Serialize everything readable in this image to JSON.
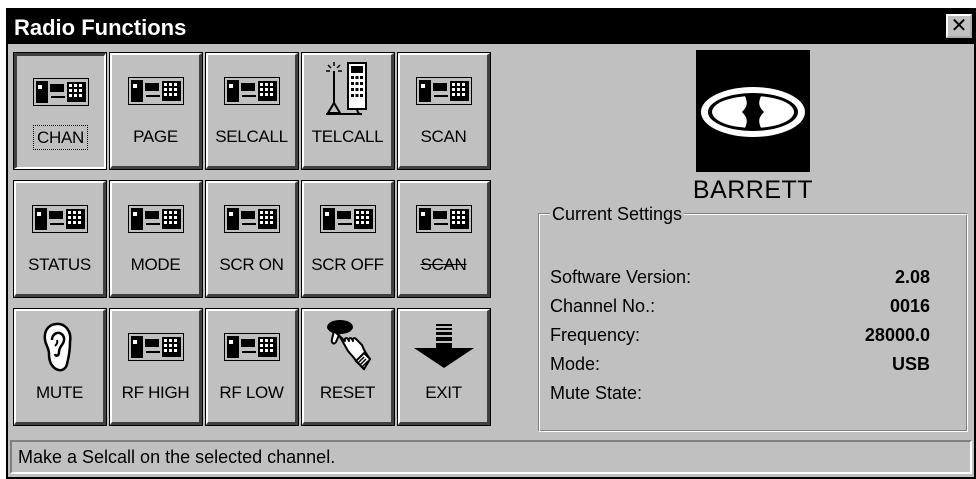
{
  "window": {
    "title": "Radio Functions",
    "close_label": "✕"
  },
  "buttons": [
    {
      "label": "CHAN",
      "icon": "radio-unit-icon"
    },
    {
      "label": "PAGE",
      "icon": "radio-unit-icon"
    },
    {
      "label": "SELCALL",
      "icon": "radio-unit-icon"
    },
    {
      "label": "TELCALL",
      "icon": "telephone-antenna-icon"
    },
    {
      "label": "SCAN",
      "icon": "radio-unit-icon"
    },
    {
      "label": "STATUS",
      "icon": "radio-unit-icon"
    },
    {
      "label": "MODE",
      "icon": "radio-unit-icon"
    },
    {
      "label": "SCR ON",
      "icon": "radio-unit-icon"
    },
    {
      "label": "SCR OFF",
      "icon": "radio-unit-icon"
    },
    {
      "label": "SCAN",
      "icon": "radio-unit-icon"
    },
    {
      "label": "MUTE",
      "icon": "ear-icon"
    },
    {
      "label": "RF HIGH",
      "icon": "radio-unit-icon"
    },
    {
      "label": "RF LOW",
      "icon": "radio-unit-icon"
    },
    {
      "label": "RESET",
      "icon": "hand-pressing-button-icon"
    },
    {
      "label": "EXIT",
      "icon": "down-arrow-icon"
    }
  ],
  "brand": {
    "name": "BARRETT"
  },
  "settings": {
    "title": "Current Settings",
    "rows": [
      {
        "label": "Software Version:",
        "value": "2.08"
      },
      {
        "label": "Channel No.:",
        "value": "0016"
      },
      {
        "label": "Frequency:",
        "value": "28000.0"
      },
      {
        "label": "Mode:",
        "value": "USB"
      },
      {
        "label": "Mute State:",
        "value": ""
      }
    ]
  },
  "status_bar": {
    "text": "Make a Selcall on the selected channel."
  }
}
